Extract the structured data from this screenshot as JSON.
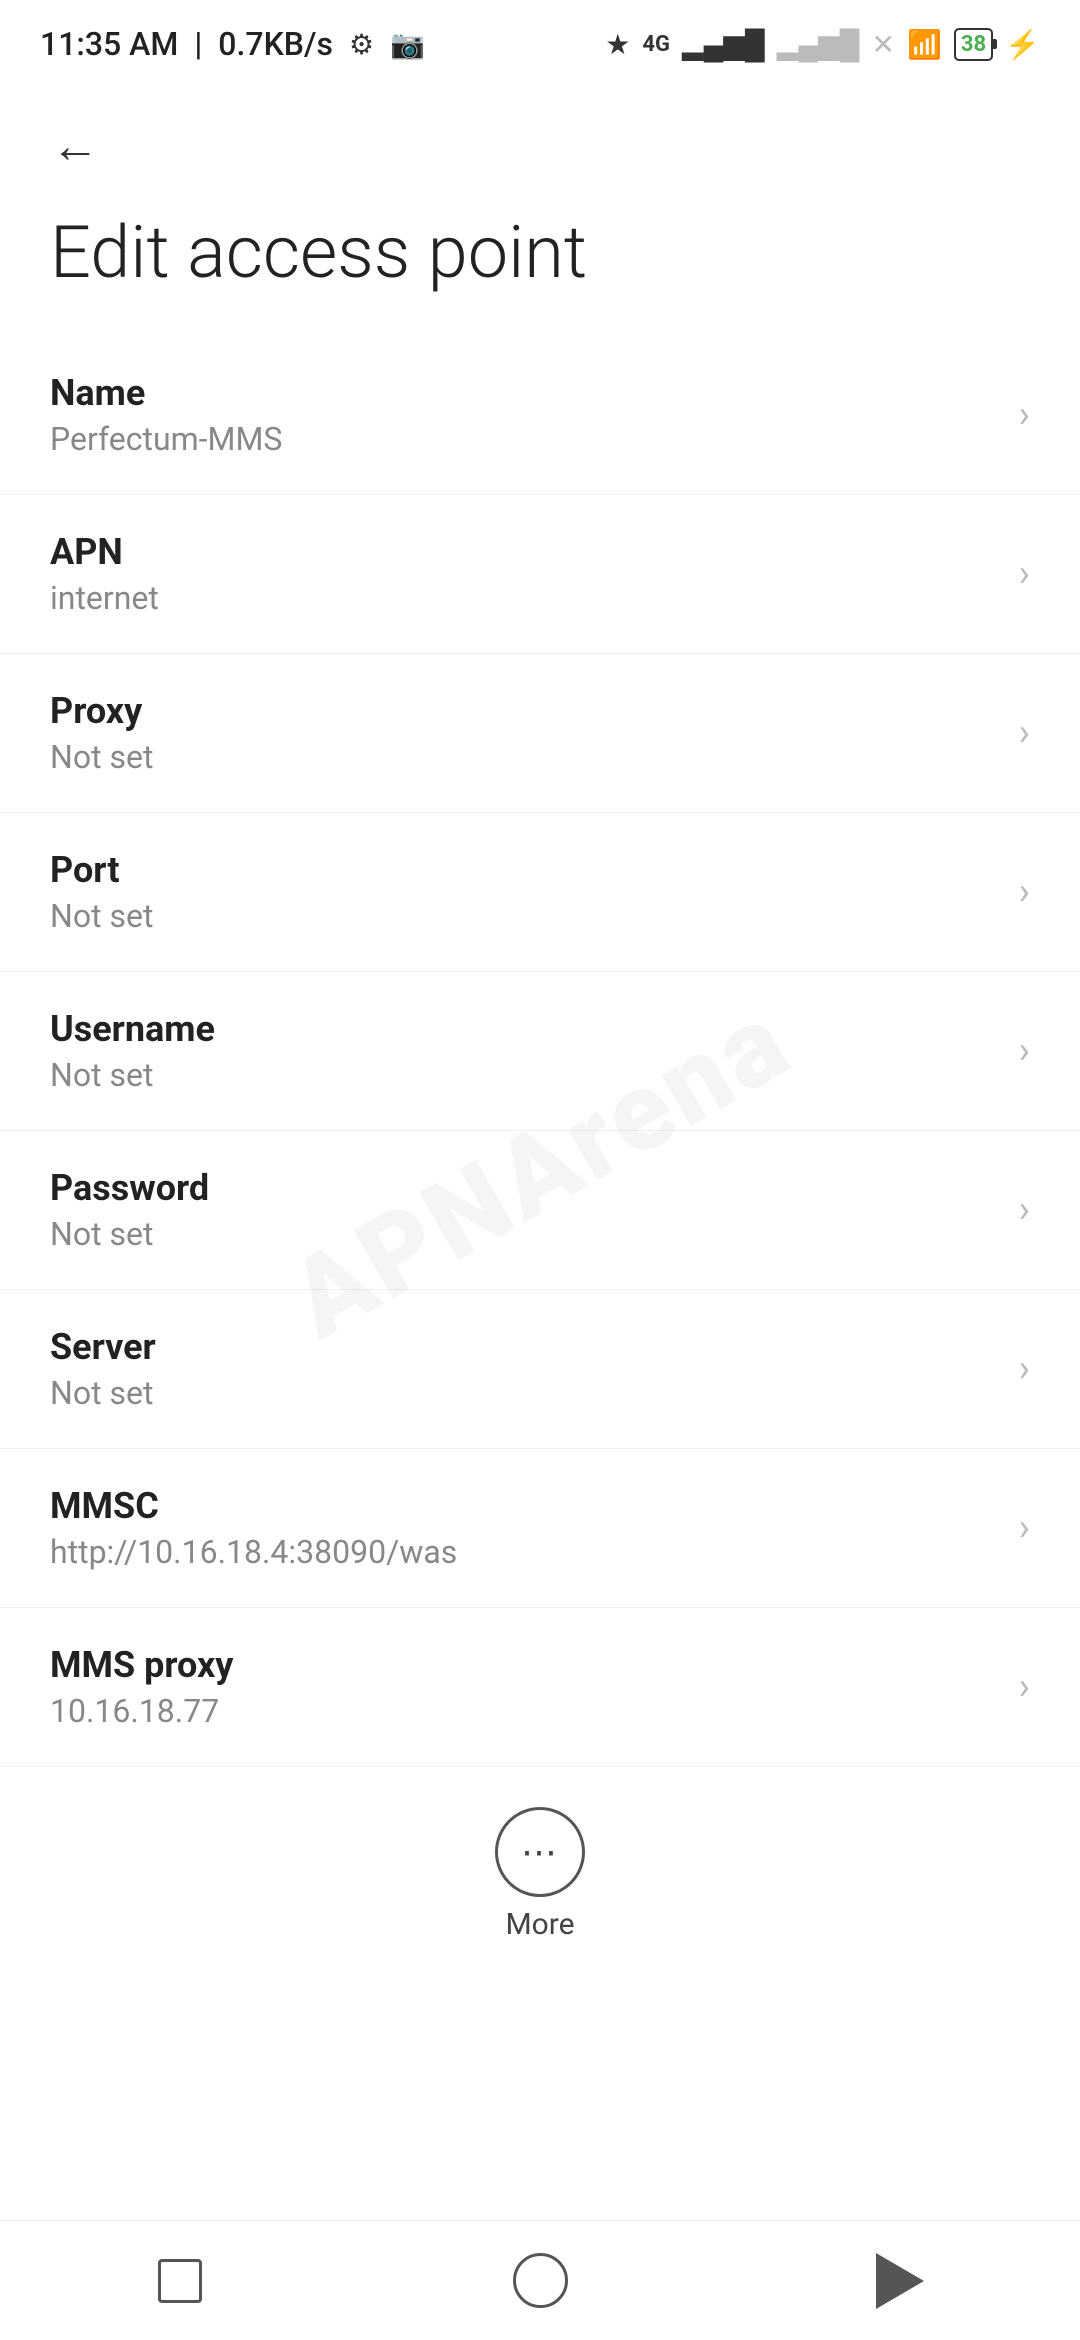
{
  "statusBar": {
    "time": "11:35 AM",
    "speed": "0.7KB/s"
  },
  "page": {
    "title": "Edit access point",
    "backLabel": "Back"
  },
  "settings": [
    {
      "label": "Name",
      "value": "Perfectum-MMS"
    },
    {
      "label": "APN",
      "value": "internet"
    },
    {
      "label": "Proxy",
      "value": "Not set"
    },
    {
      "label": "Port",
      "value": "Not set"
    },
    {
      "label": "Username",
      "value": "Not set"
    },
    {
      "label": "Password",
      "value": "Not set"
    },
    {
      "label": "Server",
      "value": "Not set"
    },
    {
      "label": "MMSC",
      "value": "http://10.16.18.4:38090/was"
    },
    {
      "label": "MMS proxy",
      "value": "10.16.18.77"
    }
  ],
  "more": {
    "label": "More"
  },
  "watermark": "APNArena"
}
